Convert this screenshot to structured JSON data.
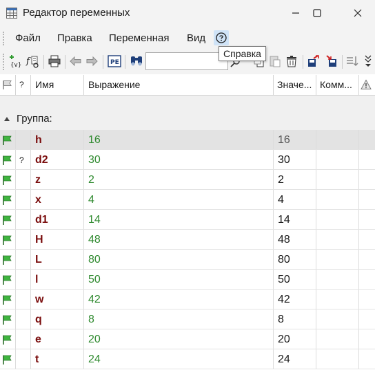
{
  "window": {
    "title": "Редактор переменных",
    "minimize_icon": "minimize-icon",
    "maximize_icon": "maximize-icon",
    "close_icon": "close-icon"
  },
  "menu": {
    "items": [
      "Файл",
      "Правка",
      "Переменная",
      "Вид"
    ],
    "help_icon": "help-circle-icon"
  },
  "tooltip": "Справка",
  "toolbar": {
    "search_value": "",
    "icons": [
      "add-variable-icon",
      "function-icon",
      "print-icon",
      "undo-icon",
      "redo-icon",
      "preview-icon",
      "find-icon",
      "copy-icon",
      "paste-icon",
      "delete-icon",
      "export-icon",
      "import-icon",
      "sort-icon",
      "overflow-icon"
    ]
  },
  "table": {
    "headers": {
      "flag": "",
      "q": "?",
      "name": "Имя",
      "expression": "Выражение",
      "value": "Значе...",
      "comment": "Комм...",
      "warn": ""
    },
    "group_label": "Группа:",
    "rows": [
      {
        "q": "",
        "name": "h",
        "expression": "16",
        "value": "16"
      },
      {
        "q": "?",
        "name": "d2",
        "expression": "30",
        "value": "30"
      },
      {
        "q": "",
        "name": "z",
        "expression": "2",
        "value": "2"
      },
      {
        "q": "",
        "name": "x",
        "expression": "4",
        "value": "4"
      },
      {
        "q": "",
        "name": "d1",
        "expression": "14",
        "value": "14"
      },
      {
        "q": "",
        "name": "H",
        "expression": "48",
        "value": "48"
      },
      {
        "q": "",
        "name": "L",
        "expression": "80",
        "value": "80"
      },
      {
        "q": "",
        "name": "l",
        "expression": "50",
        "value": "50"
      },
      {
        "q": "",
        "name": "w",
        "expression": "42",
        "value": "42"
      },
      {
        "q": "",
        "name": "q",
        "expression": "8",
        "value": "8"
      },
      {
        "q": "",
        "name": "e",
        "expression": "20",
        "value": "20"
      },
      {
        "q": "",
        "name": "t",
        "expression": "24",
        "value": "24"
      }
    ]
  },
  "colors": {
    "name_text": "#7a0d0d",
    "expression_text": "#2f8a2f",
    "flag_green": "#3fb53f",
    "selected_row": "#e3e3e3"
  }
}
